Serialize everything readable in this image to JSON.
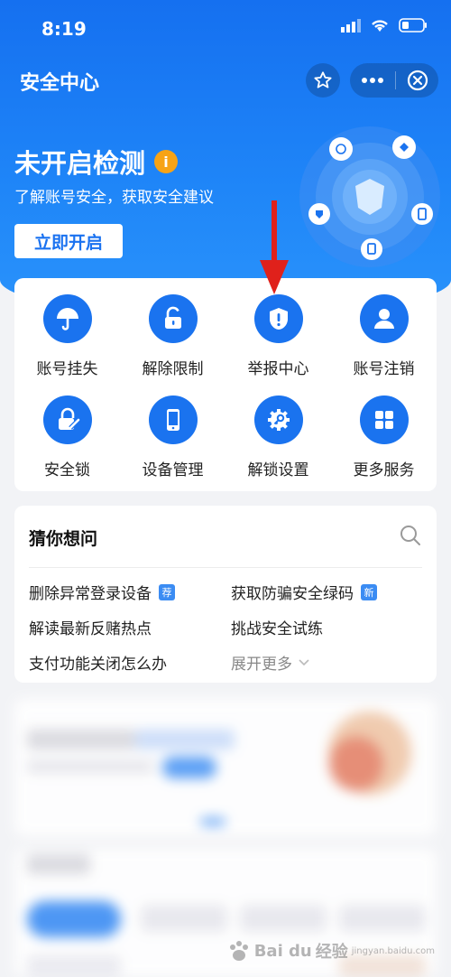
{
  "status_bar": {
    "time": "8:19"
  },
  "nav": {
    "title": "安全中心"
  },
  "hero": {
    "headline": "未开启检测",
    "info_badge": "i",
    "subline": "了解账号安全，获取安全建议",
    "button_label": "立即开启"
  },
  "services": [
    {
      "label": "账号挂失",
      "icon": "umbrella-icon"
    },
    {
      "label": "解除限制",
      "icon": "unlock-icon"
    },
    {
      "label": "举报中心",
      "icon": "shield-alert-icon"
    },
    {
      "label": "账号注销",
      "icon": "user-icon"
    },
    {
      "label": "安全锁",
      "icon": "lock-edit-icon"
    },
    {
      "label": "设备管理",
      "icon": "phone-icon"
    },
    {
      "label": "解锁设置",
      "icon": "gear-key-icon"
    },
    {
      "label": "更多服务",
      "icon": "grid-icon"
    }
  ],
  "faq": {
    "title": "猜你想问",
    "items": [
      {
        "text": "删除异常登录设备",
        "tag": "荐"
      },
      {
        "text": "获取防骗安全绿码",
        "tag": "新"
      },
      {
        "text": "解读最新反赌热点",
        "tag": ""
      },
      {
        "text": "挑战安全试练",
        "tag": ""
      },
      {
        "text": "支付功能关闭怎么办",
        "tag": ""
      },
      {
        "text": "展开更多",
        "tag": ""
      }
    ]
  },
  "watermark": {
    "brand": "Bai du",
    "sub": "经验",
    "url": "jingyan.baidu.com"
  },
  "colors": {
    "primary": "#1a73ef",
    "header": "#1f86f8",
    "badge": "#f7a316",
    "arrow": "#e0211b"
  }
}
